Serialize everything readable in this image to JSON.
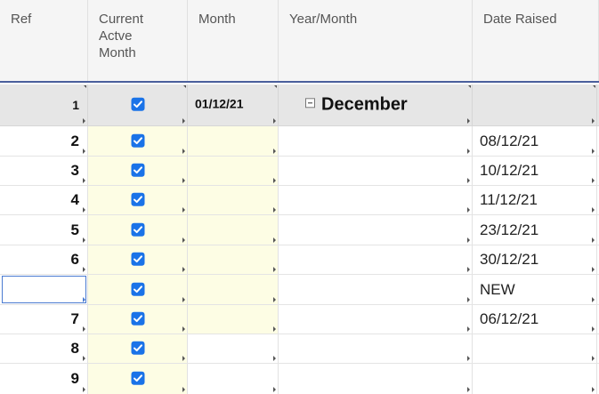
{
  "columns": {
    "ref": "Ref",
    "current_active_month": "Current\nActve\nMonth",
    "month": "Month",
    "year_month": "Year/Month",
    "date_raised": "Date Raised"
  },
  "group": {
    "ref": "1",
    "month": "01/12/21",
    "title": "December",
    "checked": true
  },
  "rows": [
    {
      "ref": "2",
      "date": "08/12/21"
    },
    {
      "ref": "3",
      "date": "10/12/21"
    },
    {
      "ref": "4",
      "date": "11/12/21"
    },
    {
      "ref": "5",
      "date": "23/12/21"
    },
    {
      "ref": "6",
      "date": "30/12/21"
    },
    {
      "ref": "",
      "date": "NEW"
    },
    {
      "ref": "7",
      "date": "06/12/21"
    },
    {
      "ref": "8",
      "date": ""
    },
    {
      "ref": "9",
      "date": ""
    }
  ],
  "colors": {
    "checkbox": "#1a73e8",
    "highlight": "#fdfde4",
    "header_border": "#4a5f9c"
  }
}
